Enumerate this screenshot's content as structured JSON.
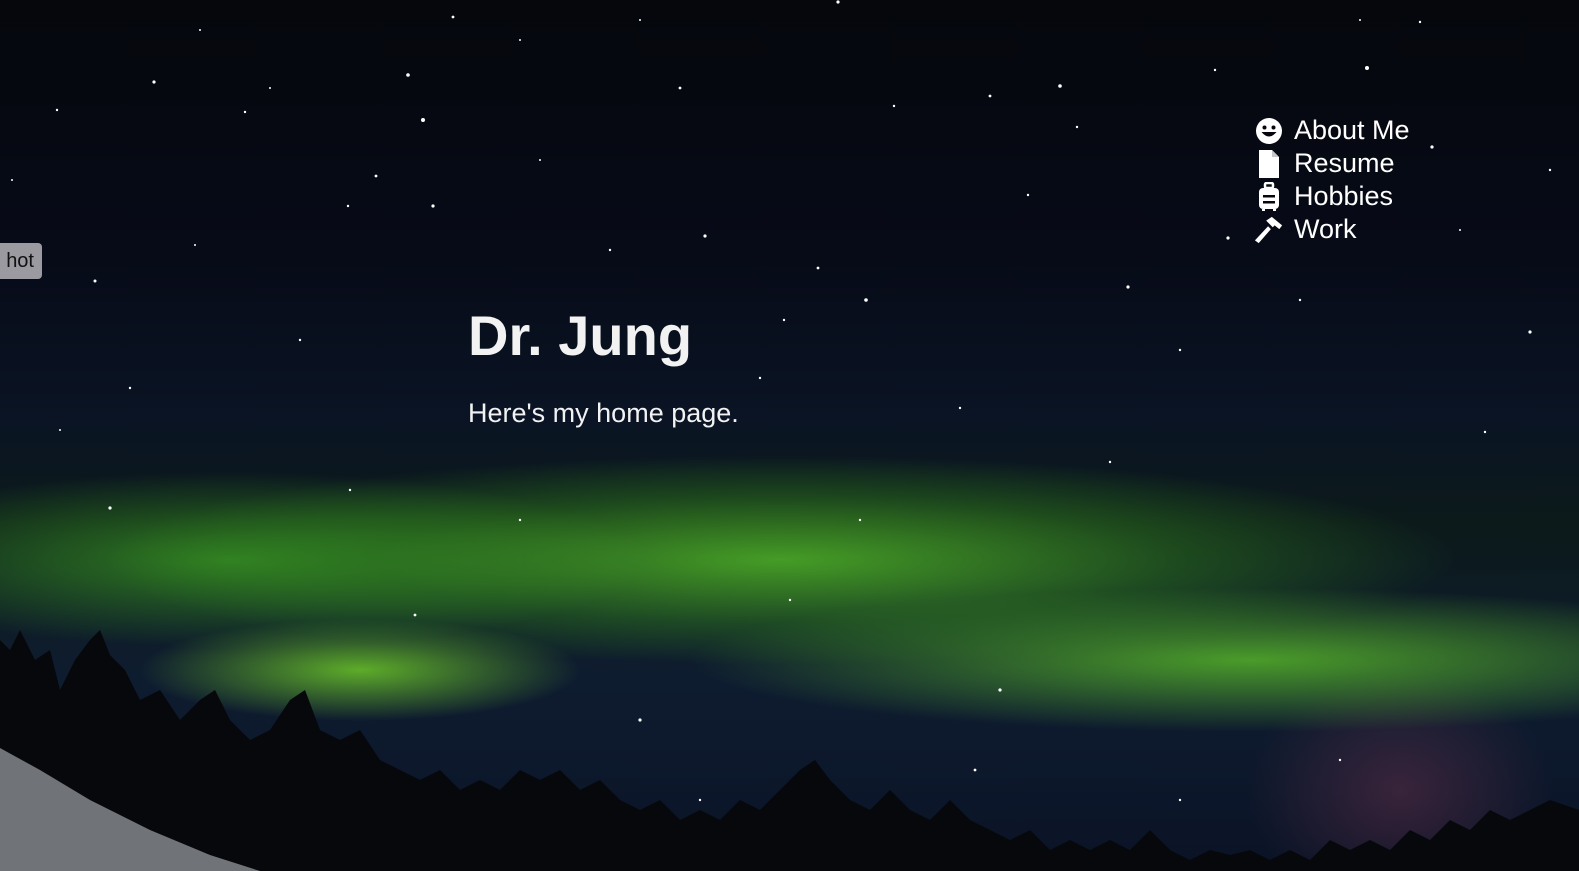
{
  "hero": {
    "title": "Dr. Jung",
    "subtitle": "Here's my home page."
  },
  "nav": {
    "items": [
      {
        "label": "About Me",
        "icon": "smiley-face-icon"
      },
      {
        "label": "Resume",
        "icon": "document-icon"
      },
      {
        "label": "Hobbies",
        "icon": "suitcase-icon"
      },
      {
        "label": "Work",
        "icon": "hammer-icon"
      }
    ]
  },
  "side_tab": {
    "label": "hot"
  },
  "colors": {
    "text": "#ffffff",
    "aurora": "#58c828",
    "sky": "#05070c",
    "tab": "#9a9aa0"
  }
}
